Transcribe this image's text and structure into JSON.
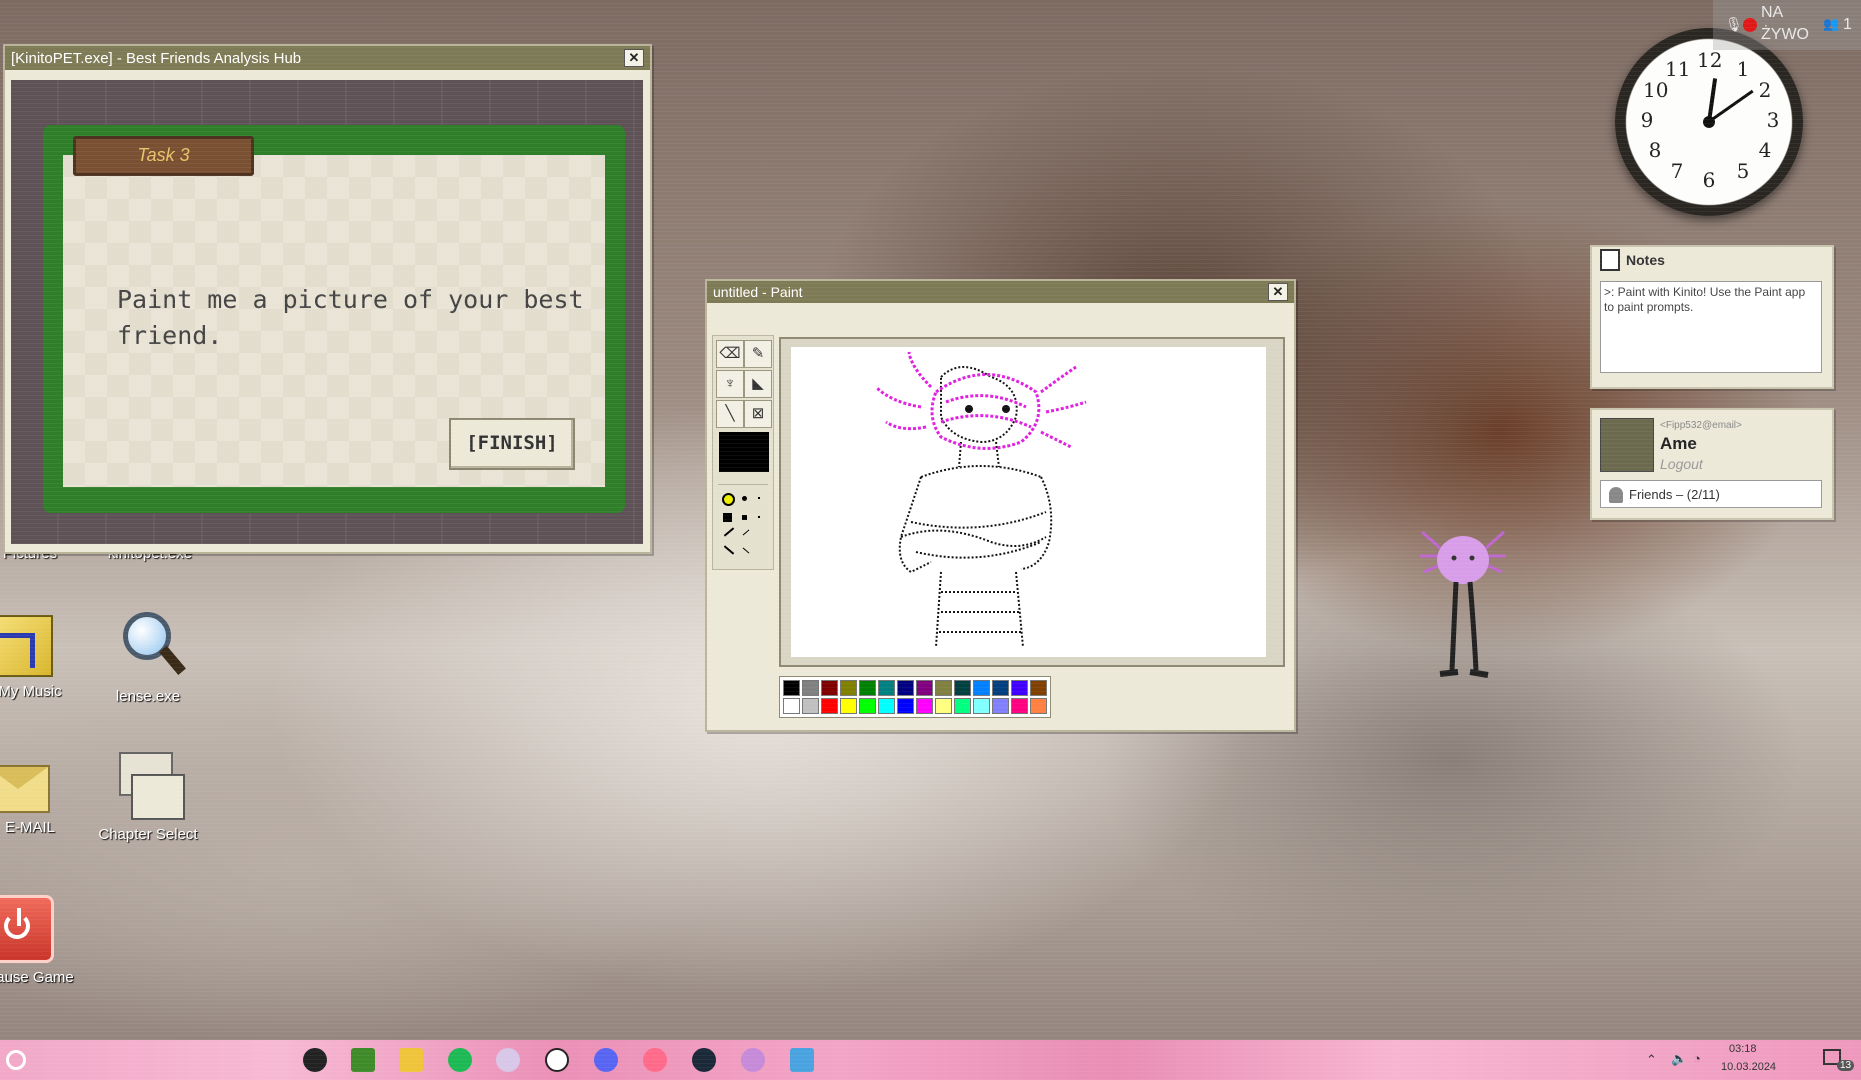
{
  "kinito_window": {
    "title": "[KinitoPET.exe] - Best Friends Analysis Hub",
    "close": "✕",
    "task_label": "Task 3",
    "prompt": "Paint me a picture of your best friend.",
    "finish_label": "[FINISH]"
  },
  "paint_window": {
    "title": "untitled - Paint",
    "close": "✕",
    "tools": [
      "eraser-tool",
      "pencil-tool",
      "brush-tool",
      "fill-tool",
      "line-tool",
      "clear-tool"
    ],
    "foreground_color": "#000000",
    "palette": [
      "#000000",
      "#808080",
      "#800000",
      "#808000",
      "#008000",
      "#008080",
      "#000080",
      "#800080",
      "#808040",
      "#004040",
      "#0080ff",
      "#004080",
      "#4000ff",
      "#804000",
      "#ffffff",
      "#c0c0c0",
      "#ff0000",
      "#ffff00",
      "#00ff00",
      "#00ffff",
      "#0000ff",
      "#ff00ff",
      "#ffff80",
      "#00ff80",
      "#80ffff",
      "#8080ff",
      "#ff0080",
      "#ff8040"
    ]
  },
  "clock": {
    "numbers": [
      "12",
      "1",
      "2",
      "3",
      "4",
      "5",
      "6",
      "7",
      "8",
      "9",
      "10",
      "11"
    ]
  },
  "notes": {
    "title": "Notes",
    "text": ">: Paint with Kinito! Use the Paint app to paint prompts."
  },
  "profile": {
    "email": "<Fipp532@email>",
    "name": "Ame",
    "logout": "Logout",
    "friends": "Friends – (2/11)"
  },
  "live": {
    "label_line1": "NA",
    "label_line2": "ŻYWO",
    "viewers": "1"
  },
  "desktop_icons": [
    {
      "label": "Pictures"
    },
    {
      "label": "kinitopet.exe"
    },
    {
      "label": "My Music"
    },
    {
      "label": "lense.exe"
    },
    {
      "label": "E-MAIL"
    },
    {
      "label": "Chapter Select"
    },
    {
      "label": "Pause Game"
    }
  ],
  "tray": {
    "time": "03:18",
    "date": "10.03.2024",
    "notifications": "13"
  },
  "colors": {
    "title_bar": "#7d7a55",
    "window_bg": "#ece9d8",
    "accent_magenta": "#e020e0"
  }
}
